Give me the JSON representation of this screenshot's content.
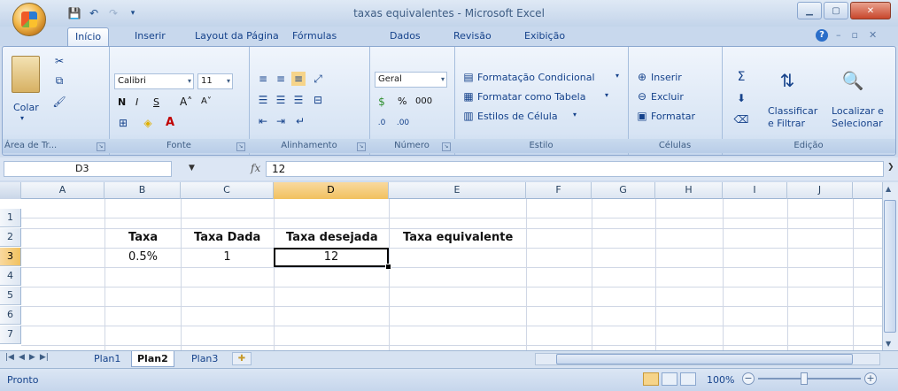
{
  "window": {
    "title": "taxas equivalentes - Microsoft Excel"
  },
  "ribbon_tabs": [
    "Início",
    "Inserir",
    "Layout da Página",
    "Fórmulas",
    "Dados",
    "Revisão",
    "Exibição"
  ],
  "clipboard": {
    "paste": "Colar",
    "label": "Área de Tr..."
  },
  "font": {
    "name": "Calibri",
    "size": "11",
    "bold": "N",
    "italic": "I",
    "underline": "S",
    "label": "Fonte"
  },
  "alignment": {
    "label": "Alinhamento"
  },
  "number": {
    "format": "Geral",
    "percent": "%",
    "thousands": "000",
    "label": "Número"
  },
  "styles": {
    "conditional": "Formatação Condicional",
    "table": "Formatar como Tabela",
    "cell_styles": "Estilos de Célula",
    "label": "Estilo"
  },
  "cells": {
    "insert": "Inserir",
    "delete": "Excluir",
    "format": "Formatar",
    "label": "Células"
  },
  "editing": {
    "sort_line1": "Classificar",
    "sort_line2": "e Filtrar",
    "find_line1": "Localizar e",
    "find_line2": "Selecionar",
    "label": "Edição"
  },
  "formula_bar": {
    "name_box": "D3",
    "fx": "fx",
    "value": "12"
  },
  "columns": [
    "A",
    "B",
    "C",
    "D",
    "E",
    "F",
    "G",
    "H",
    "I",
    "J"
  ],
  "rows": [
    "1",
    "2",
    "3",
    "4",
    "5",
    "6",
    "7"
  ],
  "sheet": {
    "B2": "Taxa",
    "C2": "Taxa Dada",
    "D2": "Taxa desejada",
    "E2": "Taxa equivalente",
    "B3": "0.5%",
    "C3": "1",
    "D3": "12"
  },
  "sheet_tabs": [
    "Plan1",
    "Plan2",
    "Plan3"
  ],
  "active_sheet": "Plan2",
  "status": {
    "text": "Pronto",
    "zoom": "100%"
  }
}
